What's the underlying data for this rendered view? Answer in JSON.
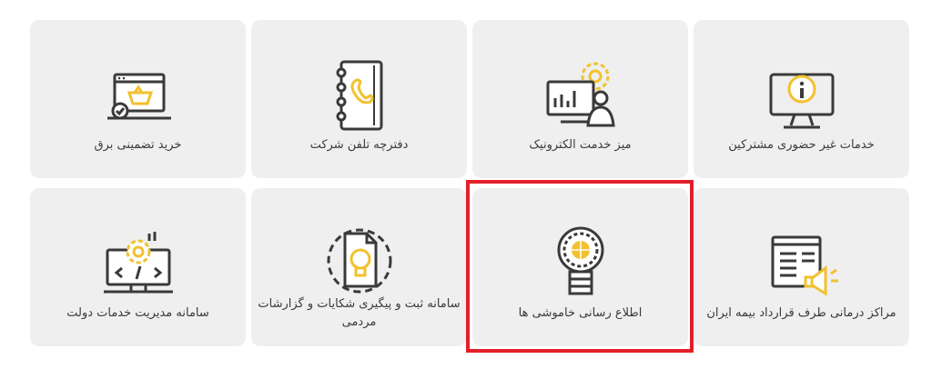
{
  "colors": {
    "card_bg": "#efefef",
    "icon_stroke": "#3a3a3a",
    "accent": "#f2c12e",
    "highlight": "#e3202a"
  },
  "cards": [
    {
      "label": "خدمات غیر حضوری مشترکین",
      "icon": "info-monitor-icon"
    },
    {
      "label": "میز خدمت الکترونیک",
      "icon": "monitor-gear-person-icon"
    },
    {
      "label": "دفترچه تلفن شرکت",
      "icon": "phone-book-icon"
    },
    {
      "label": "خرید تضمینی برق",
      "icon": "web-basket-icon"
    },
    {
      "label": "مراکز درمانی طرف قرارداد بیمه ایران",
      "icon": "news-megaphone-icon"
    },
    {
      "label": "اطلاع رسانی خاموشی ها",
      "icon": "lightbulb-gear-icon"
    },
    {
      "label": "سامانه ثبت و پیگیری شکایات و گزارشات مردمی",
      "icon": "document-gear-bulb-icon"
    },
    {
      "label": "سامانه مدیریت خدمات دولت",
      "icon": "monitor-gear-code-icon"
    }
  ]
}
